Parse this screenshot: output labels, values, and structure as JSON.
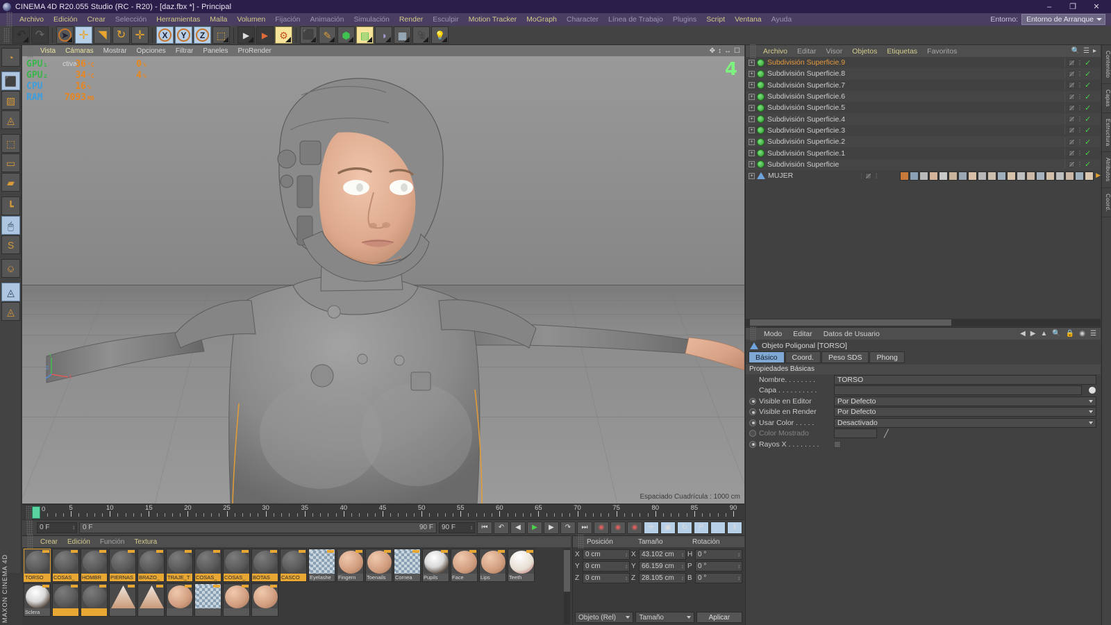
{
  "window": {
    "title": "CINEMA 4D R20.055 Studio (RC - R20) - [daz.fbx *] - Principal",
    "minimize": "–",
    "maximize": "❐",
    "close": "✕"
  },
  "menubar": {
    "items": [
      {
        "label": "Archivo",
        "dim": false
      },
      {
        "label": "Edición",
        "dim": false
      },
      {
        "label": "Crear",
        "dim": false
      },
      {
        "label": "Selección",
        "dim": true
      },
      {
        "label": "Herramientas",
        "dim": false
      },
      {
        "label": "Malla",
        "dim": false
      },
      {
        "label": "Volumen",
        "dim": false
      },
      {
        "label": "Fijación",
        "dim": true
      },
      {
        "label": "Animación",
        "dim": true
      },
      {
        "label": "Simulación",
        "dim": true
      },
      {
        "label": "Render",
        "dim": false
      },
      {
        "label": "Esculpir",
        "dim": true
      },
      {
        "label": "Motion Tracker",
        "dim": false
      },
      {
        "label": "MoGraph",
        "dim": false
      },
      {
        "label": "Character",
        "dim": true
      },
      {
        "label": "Línea de Trabajo",
        "dim": true
      },
      {
        "label": "Plugins",
        "dim": true
      },
      {
        "label": "Script",
        "dim": false
      },
      {
        "label": "Ventana",
        "dim": false
      },
      {
        "label": "Ayuda",
        "dim": true
      }
    ],
    "environment_label": "Entorno:",
    "environment_value": "Entorno de Arranque"
  },
  "toolbar": {
    "undo": "↶",
    "redo": "↷",
    "select": "➤",
    "move": "✛",
    "scale": "◥",
    "rotate": "↻",
    "axis_x": "X",
    "axis_y": "Y",
    "axis_z": "Z",
    "world_object": "⬚",
    "render_view": "▶",
    "render_region": "▶",
    "render_settings": "⚙",
    "primitive_cube": "⬛",
    "spline_pen": "✎",
    "generator": "⬢",
    "array": "▤",
    "deformer": "◑",
    "floor": "▦",
    "camera": "🎥",
    "light": "💡"
  },
  "leftbar": {
    "items": [
      {
        "name": "make-editable-icon",
        "glyph": "◔",
        "sel": false
      },
      {
        "name": "model-mode-icon",
        "glyph": "⬛",
        "sel": true
      },
      {
        "name": "texture-mode-icon",
        "glyph": "▨",
        "sel": false
      },
      {
        "name": "workplane-icon",
        "glyph": "◬",
        "sel": false
      },
      {
        "name": "points-mode-icon",
        "glyph": "⬚",
        "sel": false
      },
      {
        "name": "edges-mode-icon",
        "glyph": "▭",
        "sel": false
      },
      {
        "name": "polygons-mode-icon",
        "glyph": "▰",
        "sel": false
      },
      {
        "name": "axis-mode-icon",
        "glyph": "┗",
        "sel": false
      },
      {
        "name": "viewport-solo-icon",
        "glyph": "🖱",
        "sel": true
      },
      {
        "name": "snap-s-icon",
        "glyph": "S",
        "sel": false
      },
      {
        "name": "magnet-snap-icon",
        "glyph": "⎉",
        "sel": false
      },
      {
        "name": "lock-workplane-icon",
        "glyph": "◬",
        "sel": true
      },
      {
        "name": "rotate-workplane-icon",
        "glyph": "◬",
        "sel": false
      }
    ],
    "brand": "MAXON CINEMA 4D"
  },
  "viewport": {
    "menu": [
      {
        "label": "Vista",
        "hl": true
      },
      {
        "label": "Cámaras",
        "hl": true
      },
      {
        "label": "Mostrar",
        "hl": false
      },
      {
        "label": "Opciones",
        "hl": false
      },
      {
        "label": "Filtrar",
        "hl": false
      },
      {
        "label": "Paneles",
        "hl": false
      },
      {
        "label": "ProRender",
        "hl": false
      }
    ],
    "hud": [
      {
        "label": "GPU₁",
        "color": "green",
        "value": "36",
        "unit": "°C",
        "value2": "0",
        "unit2": "%"
      },
      {
        "label": "GPU₂",
        "color": "green",
        "value": "34",
        "unit": "°C",
        "value2": "4",
        "unit2": "%"
      },
      {
        "label": "CPU",
        "color": "blue",
        "value": "16",
        "unit": "%",
        "value2": "",
        "unit2": ""
      },
      {
        "label": "RAM",
        "color": "blue",
        "value": "7093",
        "unit": "MB",
        "value2": "",
        "unit2": ""
      }
    ],
    "active_cam": "ctiva",
    "grid_spacing": "Espaciado Cuadrícula : 1000 cm",
    "viewcount": "4",
    "axis_labels": {
      "x": "X",
      "y": "Y",
      "z": "Z"
    }
  },
  "timeline": {
    "ticks": [
      0,
      5,
      10,
      15,
      20,
      25,
      30,
      35,
      40,
      45,
      50,
      55,
      60,
      65,
      70,
      75,
      80,
      85,
      90
    ],
    "current_frame": "0",
    "frame_end_label": "0 F",
    "fields": {
      "current": "0 F",
      "preview_start": "0 F",
      "preview_end": "90 F",
      "doc_end": "90 F"
    }
  },
  "playbar": {
    "buttons": [
      {
        "name": "goto-start-button",
        "glyph": "⏮"
      },
      {
        "name": "prev-key-button",
        "glyph": "↶"
      },
      {
        "name": "step-back-button",
        "glyph": "◀"
      },
      {
        "name": "play-button",
        "glyph": "▶"
      },
      {
        "name": "step-forward-button",
        "glyph": "▶"
      },
      {
        "name": "next-key-button",
        "glyph": "↷"
      },
      {
        "name": "goto-end-button",
        "glyph": "⏭"
      },
      {
        "name": "record-active-button",
        "glyph": "◉"
      },
      {
        "name": "autokey-button",
        "glyph": "◉"
      },
      {
        "name": "keyframe-select-button",
        "glyph": "◉"
      },
      {
        "name": "position-key-button",
        "glyph": "✛"
      },
      {
        "name": "scale-key-button",
        "glyph": "▣"
      },
      {
        "name": "rotation-key-button",
        "glyph": "↻"
      },
      {
        "name": "param-key-button",
        "glyph": "P"
      },
      {
        "name": "point-level-anim-button",
        "glyph": "⸫"
      },
      {
        "name": "timeline-toggle-button",
        "glyph": "‖"
      }
    ]
  },
  "materials": {
    "menu": [
      {
        "label": "Crear",
        "dim": false
      },
      {
        "label": "Edición",
        "dim": false
      },
      {
        "label": "Función",
        "dim": true
      },
      {
        "label": "Textura",
        "dim": false
      }
    ],
    "row1": [
      {
        "name": "TORSO",
        "kind": "gray",
        "sel": true
      },
      {
        "name": "COSAS_",
        "kind": "gray",
        "sel": false
      },
      {
        "name": "HOMBR",
        "kind": "gray",
        "sel": false
      },
      {
        "name": "PIERNAS",
        "kind": "gray",
        "sel": false
      },
      {
        "name": "BRAZO_",
        "kind": "gray",
        "sel": false
      },
      {
        "name": "TRAJE_T",
        "kind": "gray",
        "sel": false
      },
      {
        "name": "COSAS_",
        "kind": "gray",
        "sel": false
      },
      {
        "name": "COSAS_",
        "kind": "gray",
        "sel": false
      },
      {
        "name": "BOTAS",
        "kind": "gray",
        "sel": false
      },
      {
        "name": "CASCO",
        "kind": "gray",
        "sel": false
      },
      {
        "name": "Eyelashe",
        "kind": "alpha",
        "sel": false
      },
      {
        "name": "Fingern",
        "kind": "skin",
        "sel": false
      },
      {
        "name": "Toenails",
        "kind": "skin",
        "sel": false
      },
      {
        "name": "Cornea",
        "kind": "alpha",
        "sel": false
      },
      {
        "name": "Pupils",
        "kind": "eye",
        "sel": false
      },
      {
        "name": "Face",
        "kind": "skin",
        "sel": false
      },
      {
        "name": "Lips",
        "kind": "skin",
        "sel": false
      },
      {
        "name": "Teeth",
        "kind": "teeth",
        "sel": false
      },
      {
        "name": "Sclera",
        "kind": "eye",
        "sel": false
      }
    ],
    "row2": [
      {
        "name": "",
        "kind": "gray",
        "sel": false
      },
      {
        "name": "",
        "kind": "gray",
        "sel": false
      },
      {
        "name": "",
        "kind": "cone",
        "sel": false
      },
      {
        "name": "",
        "kind": "cone",
        "sel": false
      },
      {
        "name": "",
        "kind": "skin",
        "sel": false
      },
      {
        "name": "",
        "kind": "alpha",
        "sel": false
      },
      {
        "name": "",
        "kind": "skin",
        "sel": false
      },
      {
        "name": "",
        "kind": "skin",
        "sel": false
      }
    ]
  },
  "coordinates": {
    "headers": [
      "Posición",
      "Tamaño",
      "Rotación"
    ],
    "rows": [
      {
        "pos_axis": "X",
        "pos": "0 cm",
        "size_axis": "X",
        "size": "43.102 cm",
        "rot_axis": "H",
        "rot": "0 °"
      },
      {
        "pos_axis": "Y",
        "pos": "0 cm",
        "size_axis": "Y",
        "size": "66.159 cm",
        "rot_axis": "P",
        "rot": "0 °"
      },
      {
        "pos_axis": "Z",
        "pos": "0 cm",
        "size_axis": "Z",
        "size": "28.105 cm",
        "rot_axis": "B",
        "rot": "0 °"
      }
    ],
    "mode": "Objeto (Rel)",
    "scale_mode": "Tamaño",
    "apply": "Aplicar"
  },
  "object_manager": {
    "menu": [
      {
        "label": "Archivo",
        "dim": false
      },
      {
        "label": "Editar",
        "dim": true
      },
      {
        "label": "Visor",
        "dim": true
      },
      {
        "label": "Objetos",
        "dim": false
      },
      {
        "label": "Etiquetas",
        "dim": false
      },
      {
        "label": "Favoritos",
        "dim": true
      }
    ],
    "items": [
      {
        "label": "Subdivisión Superficie.9",
        "type": "sds",
        "sel": true,
        "tags": false
      },
      {
        "label": "Subdivisión Superficie.8",
        "type": "sds",
        "sel": false,
        "tags": false
      },
      {
        "label": "Subdivisión Superficie.7",
        "type": "sds",
        "sel": false,
        "tags": false
      },
      {
        "label": "Subdivisión Superficie.6",
        "type": "sds",
        "sel": false,
        "tags": false
      },
      {
        "label": "Subdivisión Superficie.5",
        "type": "sds",
        "sel": false,
        "tags": false
      },
      {
        "label": "Subdivisión Superficie.4",
        "type": "sds",
        "sel": false,
        "tags": false
      },
      {
        "label": "Subdivisión Superficie.3",
        "type": "sds",
        "sel": false,
        "tags": false
      },
      {
        "label": "Subdivisión Superficie.2",
        "type": "sds",
        "sel": false,
        "tags": false
      },
      {
        "label": "Subdivisión Superficie.1",
        "type": "sds",
        "sel": false,
        "tags": false
      },
      {
        "label": "Subdivisión Superficie",
        "type": "sds",
        "sel": false,
        "tags": false
      },
      {
        "label": "MUJER",
        "type": "poly",
        "sel": false,
        "tags": true
      }
    ]
  },
  "attribute_manager": {
    "menu": [
      "Modo",
      "Editar",
      "Datos de Usuario"
    ],
    "object_title": "Objeto Poligonal [TORSO]",
    "tabs": [
      {
        "label": "Básico",
        "active": true
      },
      {
        "label": "Coord.",
        "active": false
      },
      {
        "label": "Peso SDS",
        "active": false
      },
      {
        "label": "Phong",
        "active": false
      }
    ],
    "section": "Propiedades Básicas",
    "rows": [
      {
        "label": "Nombre. . . . . . . .",
        "value": "TORSO",
        "kind": "text",
        "radio": null
      },
      {
        "label": "Capa . . . . . . . . . .",
        "value": "",
        "kind": "layer",
        "radio": null
      },
      {
        "label": "Visible en Editor",
        "value": "Por Defecto",
        "kind": "combo",
        "radio": true
      },
      {
        "label": "Visible en Render",
        "value": "Por Defecto",
        "kind": "combo",
        "radio": true
      },
      {
        "label": "Usar Color . . . . .",
        "value": "Desactivado",
        "kind": "combo",
        "radio": true
      },
      {
        "label": "Color Mostrado",
        "value": "",
        "kind": "color",
        "radio": false
      },
      {
        "label": "Rayos X . . . . . . . .",
        "value": "",
        "kind": "check",
        "radio": true
      }
    ]
  },
  "edge_dock": {
    "tabs": [
      "Contenido",
      "Capas",
      "Estructura",
      "Atributos",
      "Coord."
    ]
  }
}
